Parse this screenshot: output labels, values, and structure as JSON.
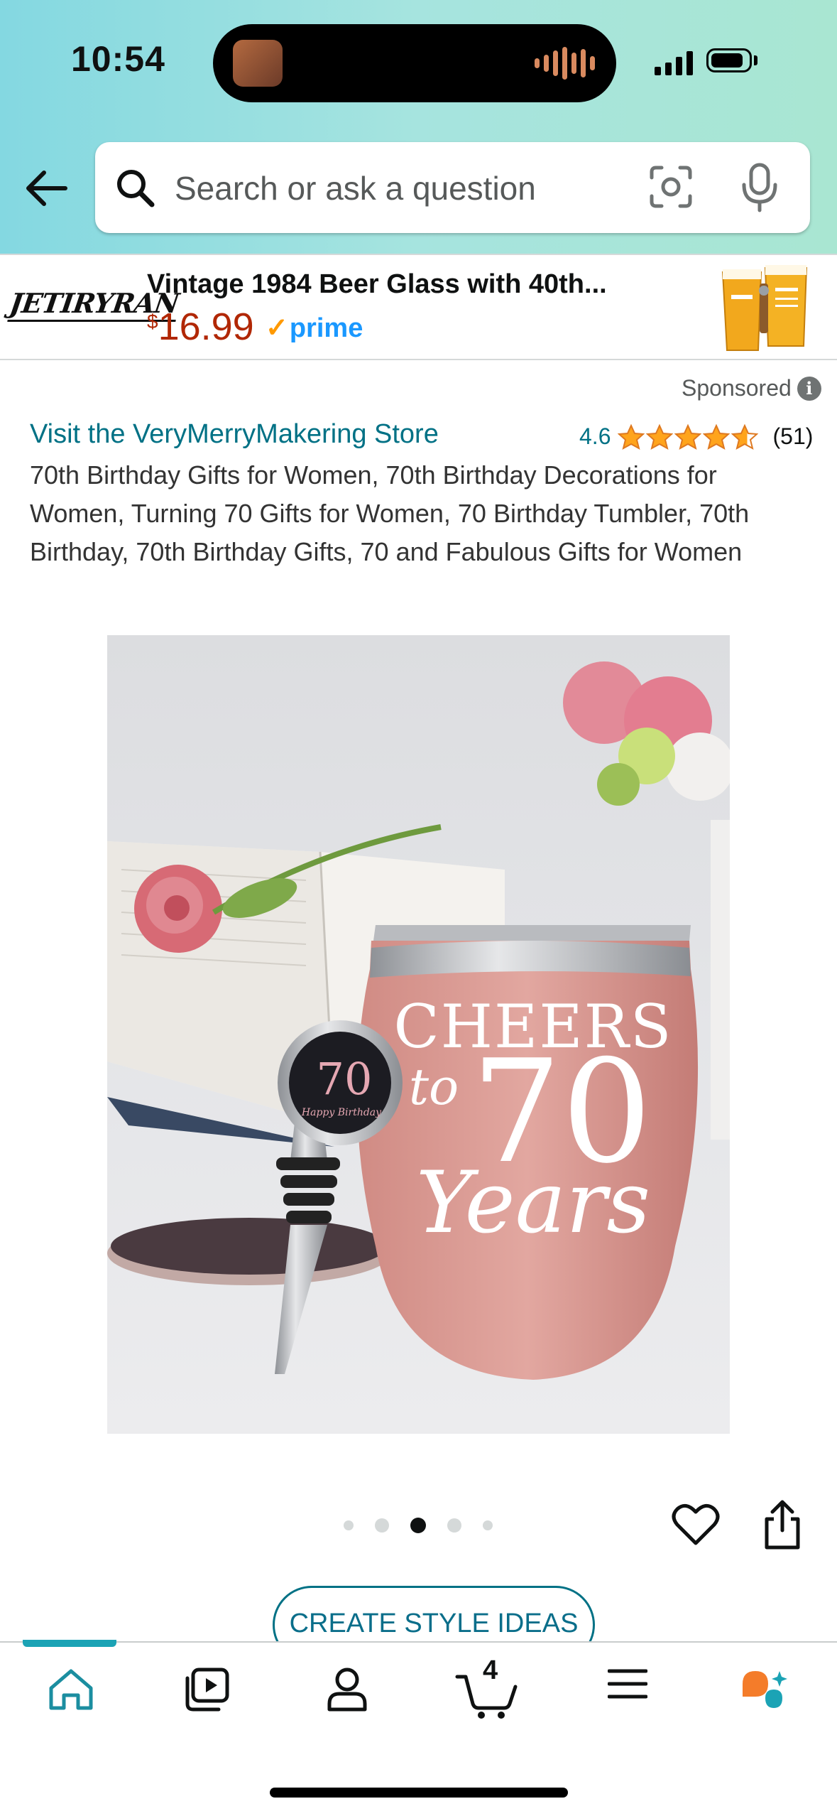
{
  "status_bar": {
    "time": "10:54"
  },
  "search": {
    "placeholder": "Search or ask a question"
  },
  "ad_banner": {
    "brand": "JETIRYRAN",
    "title": "Vintage 1984 Beer Glass with 40th...",
    "price_currency": "$",
    "price_amount": "16.99",
    "prime_label": "prime",
    "sponsored_label": "Sponsored"
  },
  "product": {
    "store_link": "Visit the VeryMerryMakering Store",
    "rating": "4.6",
    "rating_count": "(51)",
    "rating_stars": 4.6,
    "title": "70th Birthday Gifts for Women, 70th Birthday Decorations for Women, Turning 70 Gifts for Women, 70 Birthday Tumbler, 70th Birthday, 70th Birthday Gifts, 70 and Fabulous Gifts for Women",
    "image_text": {
      "line1": "CHEERS",
      "line2": "to",
      "number": "70",
      "line3": "Years",
      "stopper_number": "70",
      "stopper_text": "Happy Birthday"
    },
    "image_count": 5,
    "current_image": 3
  },
  "actions": {
    "create_style_ideas": "CREATE STYLE IDEAS"
  },
  "bottom_nav": {
    "items": [
      "home-icon",
      "video-icon",
      "account-icon",
      "cart-icon",
      "menu-icon",
      "rufus-icon"
    ],
    "active": "home",
    "cart_count": "4"
  },
  "colors": {
    "link": "#007185",
    "price": "#b12704",
    "prime": "#1a98ff",
    "star": "#ffa41c",
    "active_nav": "#1ba3b5"
  }
}
